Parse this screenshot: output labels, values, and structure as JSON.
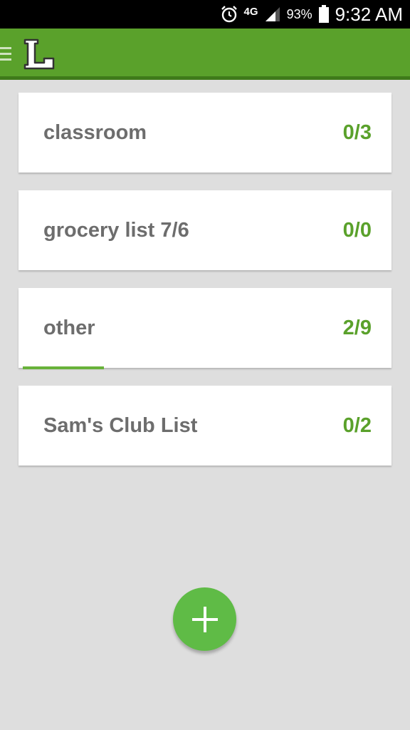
{
  "status_bar": {
    "network": "4G",
    "battery_percent": "93%",
    "time": "9:32 AM",
    "icons": [
      "alarm-icon",
      "signal-icon",
      "battery-icon"
    ]
  },
  "app_bar": {
    "logo_letter": "L",
    "icons": [
      "menu-icon"
    ]
  },
  "lists": [
    {
      "title": "classroom",
      "count": "0/3",
      "done": 0,
      "total": 3
    },
    {
      "title": "grocery list 7/6",
      "count": "0/0",
      "done": 0,
      "total": 0
    },
    {
      "title": "other",
      "count": "2/9",
      "done": 2,
      "total": 9
    },
    {
      "title": "Sam's Club List",
      "count": "0/2",
      "done": 0,
      "total": 2
    }
  ],
  "fab": {
    "icon": "plus-icon"
  },
  "colors": {
    "accent": "#5aa12b",
    "fab": "#5fbb46",
    "background": "#dedede"
  }
}
